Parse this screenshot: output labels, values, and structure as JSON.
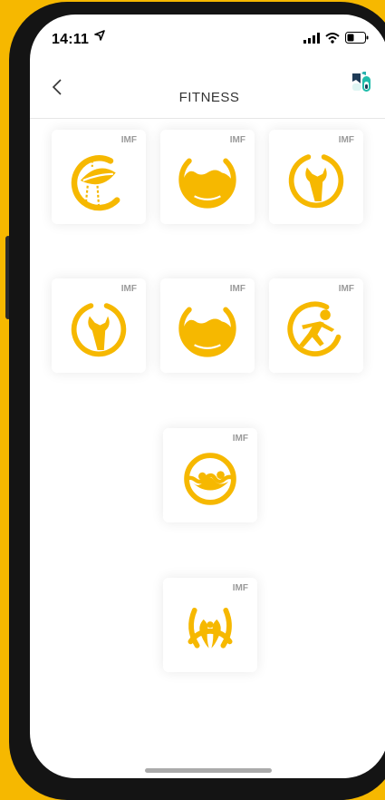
{
  "status_bar": {
    "time": "14:11"
  },
  "header": {
    "title": "FITNESS"
  },
  "tiles": [
    {
      "badge": "IMF",
      "icon": "leaf-sun-icon"
    },
    {
      "badge": "IMF",
      "icon": "bowl-fill-icon"
    },
    {
      "badge": "IMF",
      "icon": "wrench-icon"
    },
    {
      "badge": "IMF",
      "icon": "wrench-icon"
    },
    {
      "badge": "IMF",
      "icon": "bowl-fill-icon"
    },
    {
      "badge": "IMF",
      "icon": "running-figure-icon"
    },
    {
      "badge": "IMF",
      "icon": "grip-circle-icon"
    },
    {
      "badge": "IMF",
      "icon": "paired-drops-icon"
    }
  ],
  "colors": {
    "accent": "#F6B800",
    "background": "#FFFFFF",
    "badge": "#9A9A9A"
  }
}
